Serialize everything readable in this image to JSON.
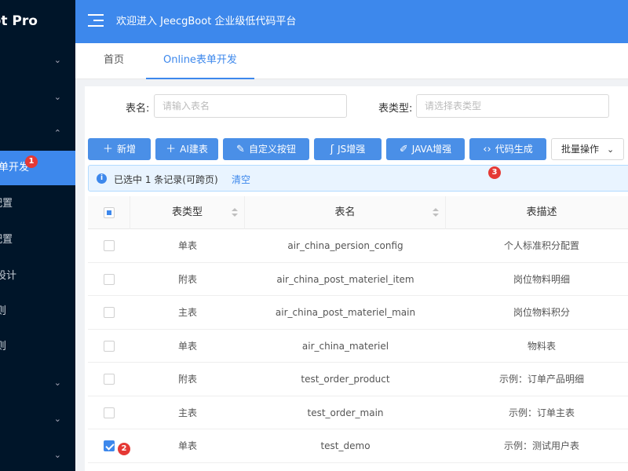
{
  "brand": {
    "name": "oot Pro"
  },
  "header": {
    "title": "欢迎进入 JeecgBoot 企业级低代码平台"
  },
  "sidebar": {
    "items": [
      {
        "label": "",
        "chevron": "⌄",
        "state": "collapsed"
      },
      {
        "label": "",
        "chevron": "⌄",
        "state": "collapsed"
      },
      {
        "label": "",
        "chevron": "⌃",
        "state": "expanded"
      },
      {
        "label": "单开发",
        "badge": "1",
        "active": true
      },
      {
        "label": "ǝ配置"
      },
      {
        "label": "ǝ配置"
      },
      {
        "label": "版设计"
      },
      {
        "label": "规则"
      },
      {
        "label": "规则"
      },
      {
        "label": "",
        "chevron": "⌄"
      },
      {
        "label": "十",
        "chevron": "⌄"
      },
      {
        "label": "",
        "chevron": "⌄"
      }
    ]
  },
  "tabs": [
    {
      "label": "首页",
      "active": false
    },
    {
      "label": "Online表单开发",
      "active": true
    }
  ],
  "search": {
    "table_name_label": "表名:",
    "table_name_placeholder": "请输入表名",
    "table_type_label": "表类型:",
    "table_type_placeholder": "请选择表类型"
  },
  "toolbar": {
    "add": "新增",
    "ai_build": "AI建表",
    "custom_button": "自定义按钮",
    "js_enhance": "JS增强",
    "java_enhance": "JAVA增强",
    "code_gen": "代码生成",
    "batch": "批量操作"
  },
  "alert": {
    "selected_text": "已选中 1 条记录(可跨页)",
    "clear": "清空"
  },
  "annotations": {
    "badge1": "1",
    "badge2": "2",
    "badge3": "3"
  },
  "table": {
    "columns": [
      "表类型",
      "表名",
      "表描述"
    ],
    "rows": [
      {
        "type": "单表",
        "name": "air_china_persion_config",
        "desc": "个人标准积分配置",
        "checked": false
      },
      {
        "type": "附表",
        "name": "air_china_post_materiel_item",
        "desc": "岗位物料明细",
        "checked": false
      },
      {
        "type": "主表",
        "name": "air_china_post_materiel_main",
        "desc": "岗位物料积分",
        "checked": false
      },
      {
        "type": "单表",
        "name": "air_china_materiel",
        "desc": "物料表",
        "checked": false
      },
      {
        "type": "附表",
        "name": "test_order_product",
        "desc": "示例：订单产品明细",
        "checked": false
      },
      {
        "type": "主表",
        "name": "test_order_main",
        "desc": "示例：订单主表",
        "checked": false
      },
      {
        "type": "单表",
        "name": "test_demo",
        "desc": "示例：测试用户表",
        "checked": true
      }
    ]
  },
  "colors": {
    "primary": "#3d88ec",
    "sidebar_bg": "#001529",
    "badge_red": "#e53935"
  }
}
